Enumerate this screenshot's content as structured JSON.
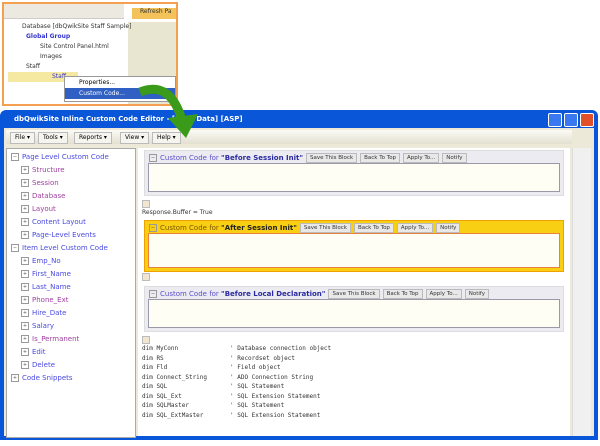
{
  "inset": {
    "tree": [
      "Database [dbQwikSite Staff Sample]",
      "Global Group",
      "Site Control Panel.html",
      "Images",
      "Staff",
      "Staff"
    ],
    "refresh_label": "Refresh Pa",
    "context_menu": [
      "Properties...",
      "Custom Code..."
    ]
  },
  "window": {
    "title": "dbQwikSite Inline Custom Code Editor - [Staff Data] [ASP]"
  },
  "menu": [
    "File",
    "Tools",
    "Reports",
    "View",
    "Help"
  ],
  "sidebar": {
    "groups": [
      {
        "label": "Page Level Custom Code",
        "items": [
          "Structure",
          "Session",
          "Database",
          "Layout",
          "Content Layout",
          "Page-Level Events"
        ]
      },
      {
        "label": "Item Level Custom Code",
        "items": [
          "Emp_No",
          "First_Name",
          "Last_Name",
          "Phone_Ext",
          "Hire_Date",
          "Salary",
          "Is_Permanent",
          "Edit",
          "Delete"
        ]
      },
      {
        "label": "Code Snippets",
        "items": []
      }
    ]
  },
  "blocks": [
    {
      "prefix": "Custom Code for ",
      "name": "\"Before Session Init\"",
      "active": false
    },
    {
      "prefix": "Custom Code for ",
      "name": "\"After Session Init\"",
      "active": true
    },
    {
      "prefix": "Custom Code for ",
      "name": "\"Before Local Declaration\"",
      "active": false
    }
  ],
  "block_buttons": [
    "Save This Block",
    "Back To Top",
    "Apply To...",
    "Notify"
  ],
  "code_between": "Response.Buffer = True",
  "code_lines": [
    [
      "dim MyConn",
      "' Database connection object"
    ],
    [
      "dim RS",
      "' Recordset object"
    ],
    [
      "dim Fld",
      "' Field object"
    ],
    [
      "dim Connect_String",
      "' ADO Connection String"
    ],
    [
      "dim SQL",
      "' SQL Statement"
    ],
    [
      "dim SQL_Ext",
      "' SQL Extension Statement"
    ],
    [
      "dim SQLMaster",
      "' SQL Statement"
    ],
    [
      "dim SQL_ExtMaster",
      "' SQL Extension Statement"
    ]
  ],
  "colors": {
    "accent": "#0a56d8",
    "active_block": "#f9cf14",
    "link": "#5a50c8",
    "arrow": "#3a9a1a"
  }
}
